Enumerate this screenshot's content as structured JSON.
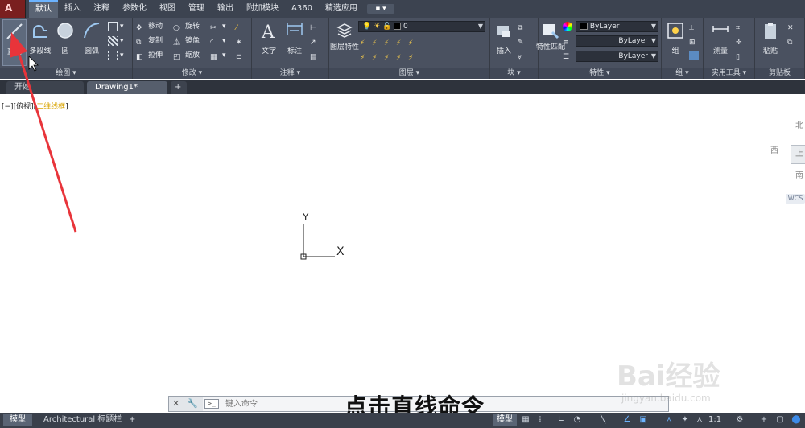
{
  "menu": {
    "tabs": [
      "默认",
      "插入",
      "注释",
      "参数化",
      "视图",
      "管理",
      "输出",
      "附加模块",
      "A360",
      "精选应用"
    ],
    "active_tab": "默认"
  },
  "ribbon": {
    "draw": {
      "title": "绘图",
      "line": "直线",
      "polyline": "多段线",
      "circle": "圆",
      "arc": "圆弧"
    },
    "modify": {
      "title": "修改",
      "move": "移动",
      "rotate": "旋转",
      "copy": "复制",
      "mirror": "镜像",
      "stretch": "拉伸",
      "scale": "缩放"
    },
    "annotation": {
      "title": "注释",
      "text": "文字",
      "dim": "标注"
    },
    "layers": {
      "title": "图层",
      "layer_props": "图层特性",
      "current_layer": "0"
    },
    "block": {
      "title": "块",
      "insert": "插入"
    },
    "properties": {
      "title": "特性",
      "match": "特性匹配",
      "color": "ByLayer",
      "linetype": "ByLayer",
      "lineweight": "ByLayer"
    },
    "groups": {
      "title": "组",
      "group": "组"
    },
    "utilities": {
      "title": "实用工具",
      "measure": "测量"
    },
    "clipboard": {
      "title": "剪贴板",
      "paste": "粘贴"
    }
  },
  "doc_tabs": {
    "start": "开始",
    "drawing": "Drawing1*",
    "add": "+"
  },
  "viewport": {
    "controls_prefix": "[−][俯视][",
    "visual_style": "二维线框",
    "controls_suffix": "]"
  },
  "viewcube": {
    "north": "北",
    "west": "西",
    "south": "南",
    "face": "上",
    "wcs": "WCS"
  },
  "ucs": {
    "y": "Y",
    "x": "X"
  },
  "command": {
    "placeholder": "键入命令"
  },
  "caption": "点击直线命令",
  "status": {
    "model_tab": "模型",
    "layout_tab": "Architectural 标题栏",
    "add": "+",
    "model_btn": "模型",
    "scale": "1:1"
  },
  "watermark": {
    "brand": "Bai经验",
    "url": "jingyan.baidu.com"
  },
  "colors": {
    "ribbon_bg": "#4a5160",
    "menubar_bg": "#3c4350",
    "arrow": "#e8343a",
    "accent": "#6cb3ff"
  }
}
